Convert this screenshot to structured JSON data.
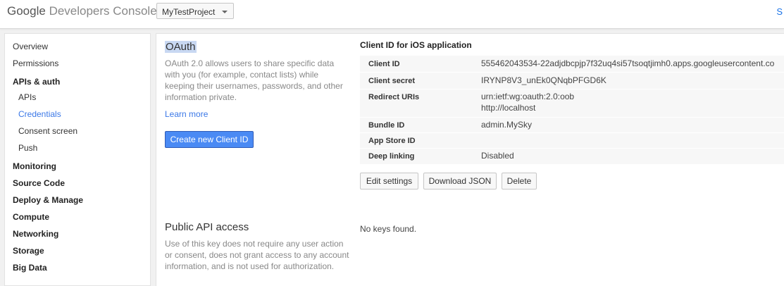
{
  "header": {
    "brand_google": "Google",
    "brand_rest": "Developers Console",
    "project": "MyTestProject",
    "top_right_link": "S"
  },
  "sidebar": {
    "items": [
      {
        "label": "Overview"
      },
      {
        "label": "Permissions"
      },
      {
        "label": "APIs & auth"
      },
      {
        "label": "APIs"
      },
      {
        "label": "Credentials"
      },
      {
        "label": "Consent screen"
      },
      {
        "label": "Push"
      },
      {
        "label": "Monitoring"
      },
      {
        "label": "Source Code"
      },
      {
        "label": "Deploy & Manage"
      },
      {
        "label": "Compute"
      },
      {
        "label": "Networking"
      },
      {
        "label": "Storage"
      },
      {
        "label": "Big Data"
      }
    ]
  },
  "oauth": {
    "title": "OAuth",
    "description": "OAuth 2.0 allows users to share specific data with you (for example, contact lists) while keeping their usernames, passwords, and other information private.",
    "learn_more": "Learn more",
    "create_button": "Create new Client ID"
  },
  "client_card": {
    "title": "Client ID for iOS application",
    "rows": [
      {
        "key": "Client ID",
        "value": "555462043534-22adjdbcpjp7f32uq4si57tsoqtjimh0.apps.googleusercontent.co"
      },
      {
        "key": "Client secret",
        "value": "IRYNP8V3_unEk0QNqbPFGD6K"
      },
      {
        "key": "Redirect URIs",
        "value": "urn:ietf:wg:oauth:2.0:oob",
        "value2": "http://localhost"
      },
      {
        "key": "Bundle ID",
        "value": "admin.MySky"
      },
      {
        "key": "App Store ID",
        "value": ""
      },
      {
        "key": "Deep linking",
        "value": "Disabled"
      }
    ],
    "buttons": {
      "edit": "Edit settings",
      "download": "Download JSON",
      "delete": "Delete"
    }
  },
  "public_api": {
    "title": "Public API access",
    "description": "Use of this key does not require any user action or consent, does not grant access to any account information, and is not used for authorization.",
    "no_keys": "No keys found."
  }
}
